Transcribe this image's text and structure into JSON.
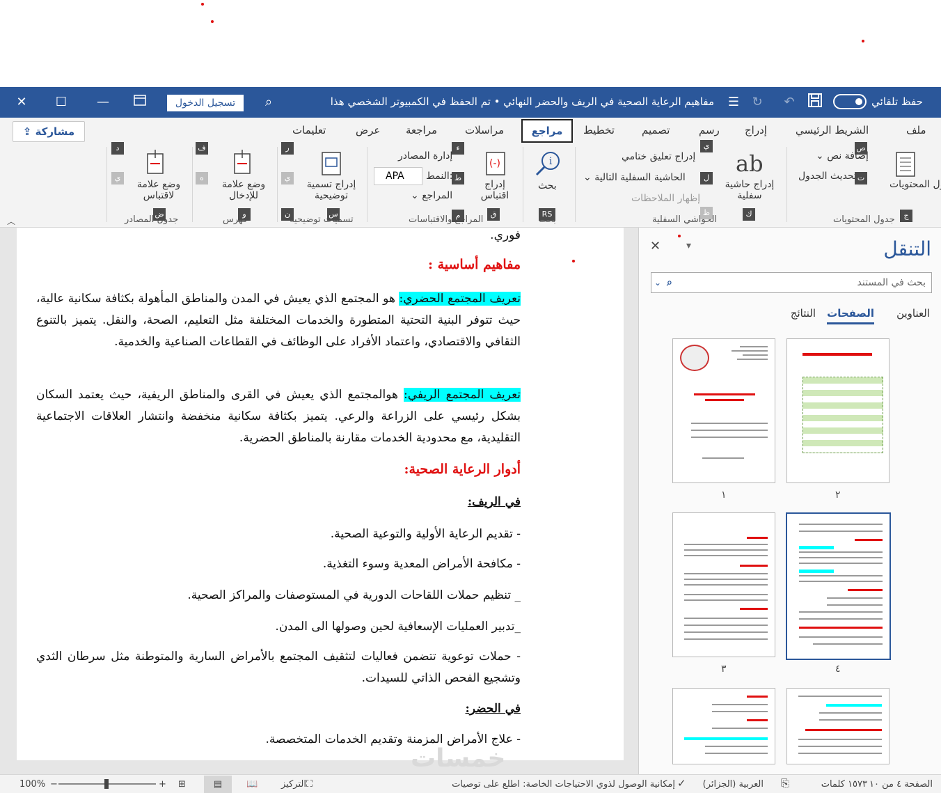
{
  "titlebar": {
    "autosave_label": "حفظ تلقائي",
    "document_title": "مفاهيم الرعاية الصحية في الريف والحضر النهائي • تم الحفظ في الكمبيوتر الشخصي هذا",
    "signin_label": "تسجيل الدخول"
  },
  "ribbon": {
    "tabs": [
      "ملف",
      "الشريط الرئيسي",
      "إدراج",
      "رسم",
      "تصميم",
      "تخطيط",
      "مراجع",
      "مراسلات",
      "مراجعة",
      "عرض",
      "تعليمات"
    ],
    "active_tab": "مراجع",
    "share_label": "مشاركة",
    "groups": {
      "toc": {
        "label": "جدول المحتويات",
        "toc_button": "جدول المحتويات",
        "add_text": "إضافة نص",
        "update_table": "تحديث الجدول"
      },
      "footnotes": {
        "label": "الحواشي السفلية",
        "insert_footnote": "إدراج حاشية سفلية",
        "insert_endnote": "إدراج تعليق ختامي",
        "next_footnote": "الحاشية السفلية التالية",
        "show_notes": "إظهار الملاحظات"
      },
      "research": {
        "label": "بحث",
        "search": "بحث"
      },
      "citations": {
        "label": "المراجع والاقتباسات",
        "insert_citation": "إدراج اقتباس",
        "manage_sources": "إدارة المصادر",
        "style_label": "النمط:",
        "style_value": "APA",
        "bibliography": "المراجع"
      },
      "captions": {
        "label": "تسميات توضيحية",
        "insert_caption": "إدراج تسمية توضيحية"
      },
      "index": {
        "label": "فهرس",
        "mark_entry": "وضع علامة للإدخال"
      },
      "authorities": {
        "label": "جدول المصادر",
        "mark_citation": "وضع علامة لاقتباس"
      }
    },
    "keytips": [
      "ص",
      "ت",
      "ج",
      "ي",
      "ل",
      "ظ",
      "ك",
      "RS",
      "ب",
      "ء",
      "ط",
      "م",
      "ق",
      "ر",
      "ي",
      "ن",
      "س",
      "ف",
      "ه",
      "و",
      "د",
      "ي",
      "ض"
    ]
  },
  "document": {
    "first_line": "فوري.",
    "heading1": "مفاهيم أساسية :",
    "urban_term": "تعريف المجتمع الحضري:",
    "urban_text": " هو المجتمع الذي يعيش في المدن والمناطق المأهولة بكثافة سكانية عالية، حيث تتوفر البنية التحتية المتطورة والخدمات المختلفة مثل التعليم، الصحة، والنقل. يتميز بالتنوع الثقافي والاقتصادي، واعتماد الأفراد على الوظائف في القطاعات الصناعية والخدمية.",
    "rural_term": "تعريف المجتمع الريفي:",
    "rural_text": " هوالمجتمع الذي يعيش في القرى والمناطق الريفية، حيث يعتمد السكان بشكل رئيسي على الزراعة والرعي. يتميز بكثافة سكانية منخفضة وانتشار العلاقات الاجتماعية التقليدية، مع محدودية الخدمات مقارنة بالمناطق الحضرية.",
    "heading2": "أدوار الرعاية الصحية:",
    "rural_sub": "في الريف:",
    "rural_items": [
      "- تقديم الرعاية الأولية والتوعية الصحية.",
      "- مكافحة الأمراض المعدية وسوء التغذية.",
      "_ تنظيم حملات اللقاحات الدورية في المستوصفات والمراكز الصحية.",
      "_تدبير العمليات الإسعافية لحين وصولها الى المدن.",
      "- حملات توعوية تتضمن فعاليات لتثقيف المجتمع بالأمراض السارية والمتوطنة مثل سرطان الثدي وتشجيع الفحص الذاتي للسيدات."
    ],
    "urban_sub": "في الحضر:",
    "urban_items": [
      "- علاج الأمراض المزمنة وتقديم الخدمات المتخصصة."
    ]
  },
  "navigation": {
    "title": "التنقل",
    "search_placeholder": "بحث في المستند",
    "tabs": [
      "العناوين",
      "الصفحات",
      "النتائج"
    ],
    "active_tab": "الصفحات",
    "thumbnails": [
      "١",
      "٢",
      "٣",
      "٤",
      "",
      ""
    ],
    "selected_thumbnail": "٤"
  },
  "statusbar": {
    "page": "الصفحة ٤ من ١٠",
    "words": "١٥٧٣ كلمات",
    "language": "العربية (الجزائر)",
    "accessibility": "إمكانية الوصول لذوي الاحتياجات الخاصة: اطلع على توصيات",
    "focus": "التركيز",
    "zoom": "100%"
  },
  "watermark": "خمسات",
  "colors": {
    "title_bar": "#2b579a",
    "heading_red": "#e01010",
    "highlight": "#00ffff",
    "ribbon_bg": "#f3f3f3"
  }
}
